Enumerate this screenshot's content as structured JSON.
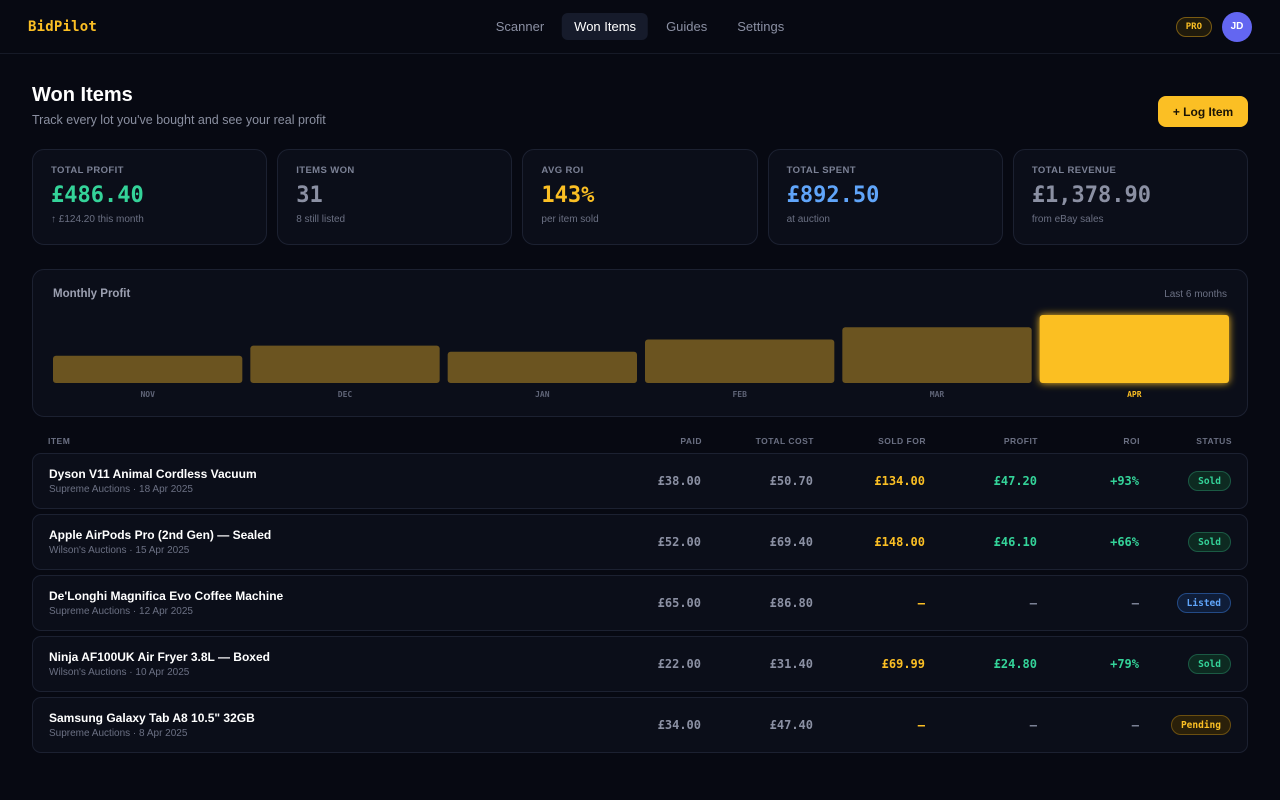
{
  "app": {
    "name": "BidPilot",
    "plan_badge": "PRO",
    "user_initials": "JD"
  },
  "nav": [
    {
      "label": "Scanner",
      "active": false
    },
    {
      "label": "Won Items",
      "active": true
    },
    {
      "label": "Guides",
      "active": false
    },
    {
      "label": "Settings",
      "active": false
    }
  ],
  "header": {
    "title": "Won Items",
    "subtitle": "Track every lot you've bought and see your real profit",
    "log_button": "+ Log Item"
  },
  "stats": [
    {
      "label": "TOTAL PROFIT",
      "value": "£486.40",
      "sub": "↑ £124.20 this month",
      "color": "#34d399"
    },
    {
      "label": "ITEMS WON",
      "value": "31",
      "sub": "8 still listed",
      "color": "#8b90a3"
    },
    {
      "label": "AVG ROI",
      "value": "143%",
      "sub": "per item sold",
      "color": "#fbbf24"
    },
    {
      "label": "TOTAL SPENT",
      "value": "£892.50",
      "sub": "at auction",
      "color": "#60a5fa"
    },
    {
      "label": "TOTAL REVENUE",
      "value": "£1,378.90",
      "sub": "from eBay sales",
      "color": "#8b90a3"
    }
  ],
  "chart_data": {
    "type": "bar",
    "title": "Monthly Profit",
    "range_label": "Last 6 months",
    "categories": [
      "NOV",
      "DEC",
      "JAN",
      "FEB",
      "MAR",
      "APR"
    ],
    "values": [
      40,
      55,
      46,
      64,
      82,
      100
    ],
    "highlight_index": 5,
    "colors": {
      "bar": "#6b5420",
      "highlight": "#fbbf24",
      "label": "#5e6376"
    }
  },
  "table": {
    "headers": {
      "item": "ITEM",
      "paid": "PAID",
      "total_cost": "TOTAL COST",
      "sold_for": "SOLD FOR",
      "profit": "PROFIT",
      "roi": "ROI",
      "status": "STATUS"
    },
    "rows": [
      {
        "name": "Dyson V11 Animal Cordless Vacuum",
        "meta": "Supreme Auctions · 18 Apr 2025",
        "paid": "£38.00",
        "total_cost": "£50.70",
        "sold_for": "£134.00",
        "profit": "£47.20",
        "roi": "+93%",
        "status": "Sold"
      },
      {
        "name": "Apple AirPods Pro (2nd Gen) — Sealed",
        "meta": "Wilson's Auctions · 15 Apr 2025",
        "paid": "£52.00",
        "total_cost": "£69.40",
        "sold_for": "£148.00",
        "profit": "£46.10",
        "roi": "+66%",
        "status": "Sold"
      },
      {
        "name": "De'Longhi Magnifica Evo Coffee Machine",
        "meta": "Supreme Auctions · 12 Apr 2025",
        "paid": "£65.00",
        "total_cost": "£86.80",
        "sold_for": "—",
        "profit": "—",
        "roi": "—",
        "status": "Listed"
      },
      {
        "name": "Ninja AF100UK Air Fryer 3.8L — Boxed",
        "meta": "Wilson's Auctions · 10 Apr 2025",
        "paid": "£22.00",
        "total_cost": "£31.40",
        "sold_for": "£69.99",
        "profit": "£24.80",
        "roi": "+79%",
        "status": "Sold"
      },
      {
        "name": "Samsung Galaxy Tab A8 10.5\" 32GB",
        "meta": "Supreme Auctions · 8 Apr 2025",
        "paid": "£34.00",
        "total_cost": "£47.40",
        "sold_for": "—",
        "profit": "—",
        "roi": "—",
        "status": "Pending"
      }
    ]
  }
}
